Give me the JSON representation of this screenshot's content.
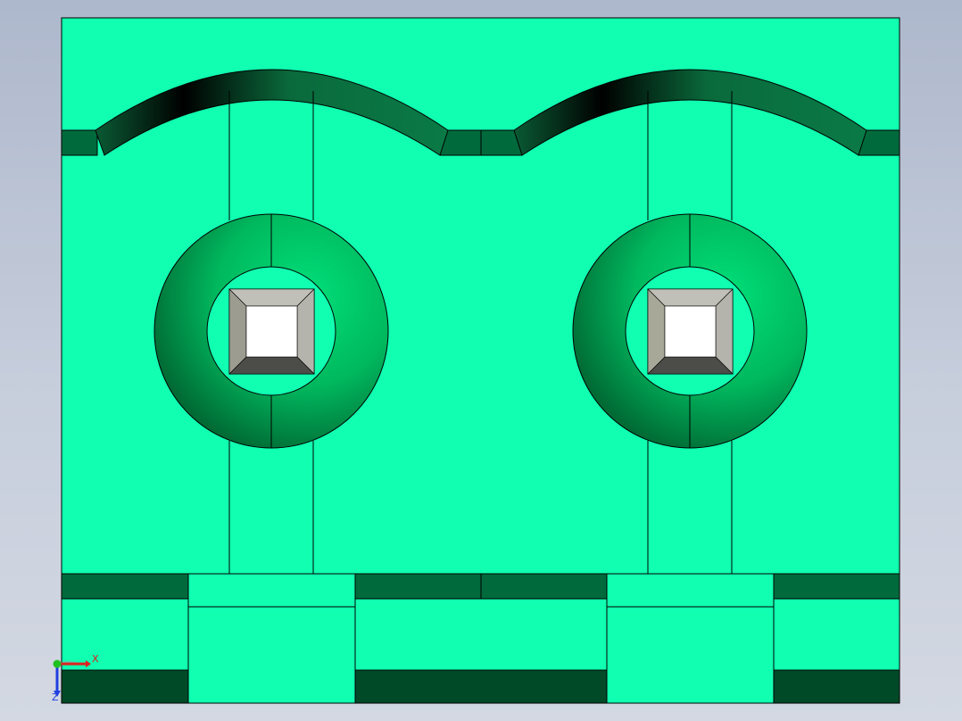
{
  "viewport": {
    "background_top": "#aeb8cc",
    "background_bottom": "#d3d8e2"
  },
  "colors": {
    "face": "#10ffb0",
    "dark_face": "#006a3c",
    "darker_face": "#004a28",
    "ring": "#00c862",
    "edge": "#000000",
    "hole_white": "#ffffff",
    "hole_bevel_light": "#c8c8c0",
    "hole_bevel_dark": "#505050"
  },
  "triad": {
    "x_label": "X",
    "z_label": "Z",
    "x_color": "#e02020",
    "y_color": "#20c020",
    "z_color": "#2040e0"
  }
}
